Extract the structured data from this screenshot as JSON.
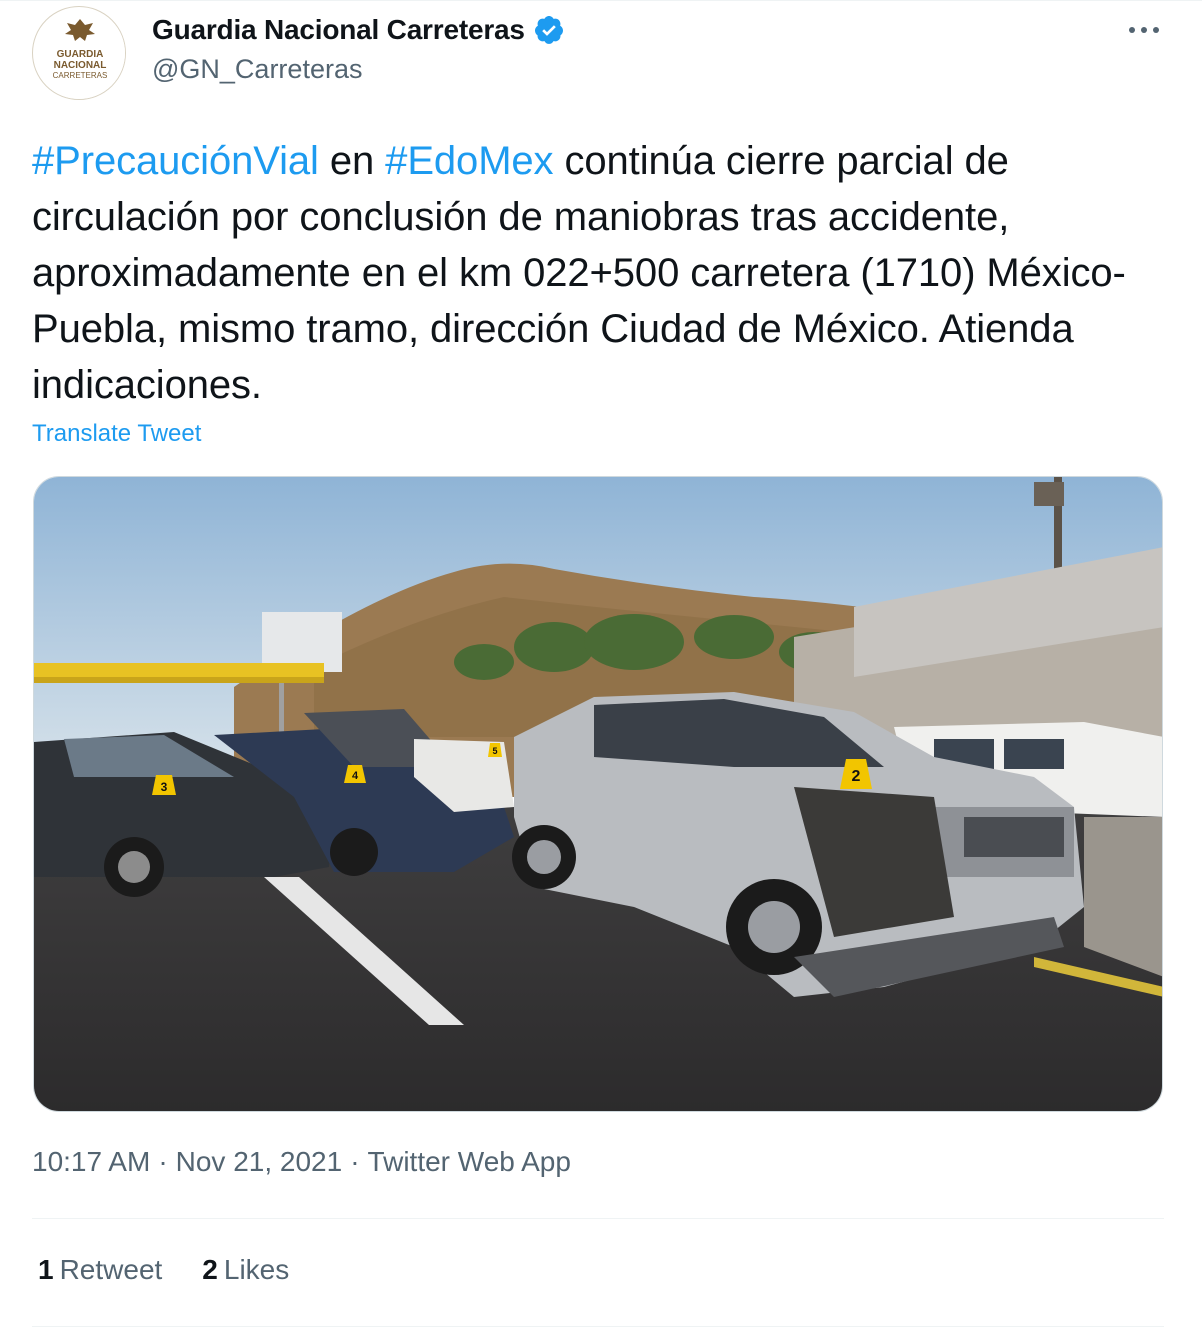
{
  "tweet": {
    "author": {
      "display_name": "Guardia Nacional Carreteras",
      "handle": "@GN_Carreteras",
      "verified": true,
      "avatar_text": [
        "GUARDIA",
        "NACIONAL",
        "CARRETERAS"
      ]
    },
    "text": {
      "hashtag1": "#PrecauciónVial",
      "part1": " en ",
      "hashtag2": "#EdoMex",
      "part2": " continúa cierre parcial de circulación por conclusión de maniobras tras accidente, aproximadamente en el km 022+500 carretera (1710) México-Puebla, mismo tramo, dirección Ciudad de México. Atienda indicaciones."
    },
    "translate_label": "Translate Tweet",
    "photo": {
      "evidence_markers": [
        "3",
        "4",
        "5",
        "2"
      ]
    },
    "meta": {
      "time": "10:17 AM",
      "separator": "·",
      "date": "Nov 21, 2021",
      "source": "Twitter Web App"
    },
    "stats": {
      "retweets_count": "1",
      "retweets_label": "Retweet",
      "likes_count": "2",
      "likes_label": "Likes"
    }
  },
  "colors": {
    "link": "#1d9bf0",
    "text": "#0f1419",
    "secondary": "#536471",
    "border": "#eff3f4"
  },
  "icons": {
    "verified": "verified-badge-icon",
    "more": "more-options-icon"
  }
}
